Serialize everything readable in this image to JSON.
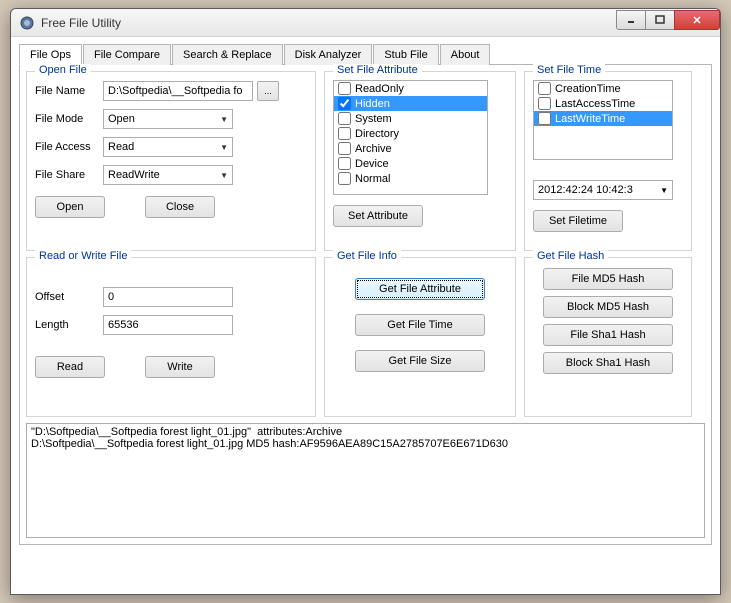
{
  "title": "Free File Utility",
  "tabs": [
    "File Ops",
    "File Compare",
    "Search & Replace",
    "Disk Analyzer",
    "Stub File",
    "About"
  ],
  "openFile": {
    "legend": "Open File",
    "fields": {
      "fileName": {
        "label": "File Name",
        "value": "D:\\Softpedia\\__Softpedia fo"
      },
      "fileMode": {
        "label": "File Mode",
        "value": "Open"
      },
      "fileAccess": {
        "label": "File Access",
        "value": "Read"
      },
      "fileShare": {
        "label": "File Share",
        "value": "ReadWrite"
      }
    },
    "browseBtn": "...",
    "openBtn": "Open",
    "closeBtn": "Close"
  },
  "setAttr": {
    "legend": "Set File Attribute",
    "items": [
      "ReadOnly",
      "Hidden",
      "System",
      "Directory",
      "Archive",
      "Device",
      "Normal"
    ],
    "checked": [
      "Hidden"
    ],
    "selected": "Hidden",
    "btn": "Set Attribute"
  },
  "setTime": {
    "legend": "Set File Time",
    "items": [
      "CreationTime",
      "LastAccessTime",
      "LastWriteTime"
    ],
    "selected": "LastWriteTime",
    "datetime": "2012:42:24 10:42:3",
    "btn": "Set Filetime"
  },
  "readWrite": {
    "legend": "Read or Write File",
    "offset": {
      "label": "Offset",
      "value": "0"
    },
    "length": {
      "label": "Length",
      "value": "65536"
    },
    "readBtn": "Read",
    "writeBtn": "Write"
  },
  "getInfo": {
    "legend": "Get File Info",
    "attrBtn": "Get File Attribute",
    "timeBtn": "Get File Time",
    "sizeBtn": "Get File Size"
  },
  "getHash": {
    "legend": "Get File Hash",
    "fileMd5": "File MD5 Hash",
    "blockMd5": "Block MD5 Hash",
    "fileSha1": "File Sha1 Hash",
    "blockSha1": "Block Sha1 Hash"
  },
  "output": "\"D:\\Softpedia\\__Softpedia forest light_01.jpg\"  attributes:Archive\nD:\\Softpedia\\__Softpedia forest light_01.jpg MD5 hash:AF9596AEA89C15A2785707E6E671D630"
}
